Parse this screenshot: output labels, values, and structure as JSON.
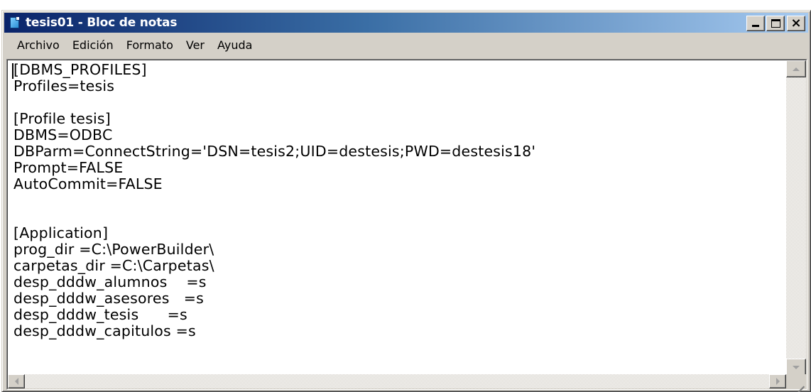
{
  "window": {
    "title": "tesis01 - Bloc de notas",
    "icon": "notepad-icon"
  },
  "title_buttons": {
    "minimize_icon": "minimize-icon",
    "maximize_icon": "maximize-icon",
    "close_label": "×"
  },
  "menu": {
    "items": [
      {
        "label": "Archivo"
      },
      {
        "label": "Edición"
      },
      {
        "label": "Formato"
      },
      {
        "label": "Ver"
      },
      {
        "label": "Ayuda"
      }
    ]
  },
  "document": {
    "lines": [
      "[DBMS_PROFILES]",
      "Profiles=tesis",
      "",
      "[Profile tesis]",
      "DBMS=ODBC",
      "DBParm=ConnectString='DSN=tesis2;UID=destesis;PWD=destesis18'",
      "Prompt=FALSE",
      "AutoCommit=FALSE",
      "",
      "",
      "[Application]",
      "prog_dir =C:\\PowerBuilder\\",
      "carpetas_dir =C:\\Carpetas\\",
      "desp_dddw_alumnos    =s",
      "desp_dddw_asesores   =s",
      "desp_dddw_tesis      =s",
      "desp_dddw_capitulos =s"
    ]
  },
  "colors": {
    "titlebar_start": "#0a246a",
    "titlebar_end": "#a6caf0",
    "chrome": "#d4d0c8"
  }
}
